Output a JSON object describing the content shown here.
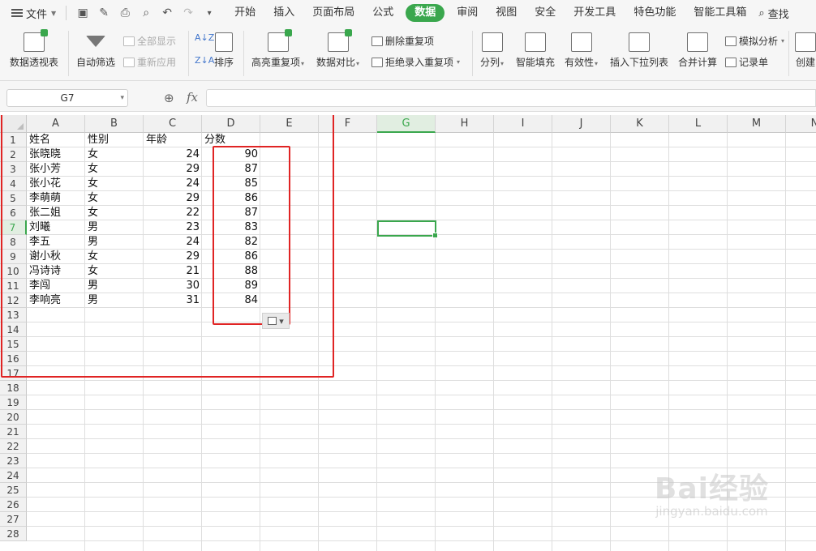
{
  "menubar": {
    "file_label": "文件",
    "tabs": [
      "开始",
      "插入",
      "页面布局",
      "公式",
      "数据",
      "审阅",
      "视图",
      "安全",
      "开发工具",
      "特色功能",
      "智能工具箱"
    ],
    "active_tab": "数据",
    "search_label": "查找"
  },
  "ribbon": {
    "pivot": "数据透视表",
    "autofilter": "自动筛选",
    "show_all": "全部显示",
    "reapply": "重新应用",
    "sort": "排序",
    "highlight_dup": "高亮重复项",
    "data_compare": "数据对比",
    "delete_dup": "删除重复项",
    "reject_dup": "拒绝录入重复项",
    "split": "分列",
    "smart_fill": "智能填充",
    "validity": "有效性",
    "insert_dropdown": "插入下拉列表",
    "merge_calc": "合并计算",
    "simulate": "模拟分析",
    "record_form": "记录单",
    "create": "创建"
  },
  "formula_bar": {
    "name_box": "G7",
    "fx_label": "fx",
    "formula": ""
  },
  "grid": {
    "columns": [
      "A",
      "B",
      "C",
      "D",
      "E",
      "F",
      "G",
      "H",
      "I",
      "J",
      "K",
      "L",
      "M",
      "N"
    ],
    "selected_column": "G",
    "selected_row": 7,
    "row_count": 28,
    "headers": [
      "姓名",
      "性别",
      "年龄",
      "分数"
    ],
    "rows": [
      {
        "name": "张晓晓",
        "gender": "女",
        "age": "24",
        "score": "90"
      },
      {
        "name": "张小芳",
        "gender": "女",
        "age": "29",
        "score": "87"
      },
      {
        "name": "张小花",
        "gender": "女",
        "age": "24",
        "score": "85"
      },
      {
        "name": "李萌萌",
        "gender": "女",
        "age": "29",
        "score": "86"
      },
      {
        "name": "张二姐",
        "gender": "女",
        "age": "22",
        "score": "87"
      },
      {
        "name": "刘曦",
        "gender": "男",
        "age": "23",
        "score": "83"
      },
      {
        "name": "李五",
        "gender": "男",
        "age": "24",
        "score": "82"
      },
      {
        "name": "谢小秋",
        "gender": "女",
        "age": "29",
        "score": "86"
      },
      {
        "name": "冯诗诗",
        "gender": "女",
        "age": "21",
        "score": "88"
      },
      {
        "name": "李闯",
        "gender": "男",
        "age": "30",
        "score": "89"
      },
      {
        "name": "李响亮",
        "gender": "男",
        "age": "31",
        "score": "84"
      }
    ]
  },
  "colors": {
    "accent": "#3aa74d",
    "highlight_box": "#e02424"
  },
  "watermark": {
    "brand": "Bai经验",
    "url": "jingyan.baidu.com"
  }
}
